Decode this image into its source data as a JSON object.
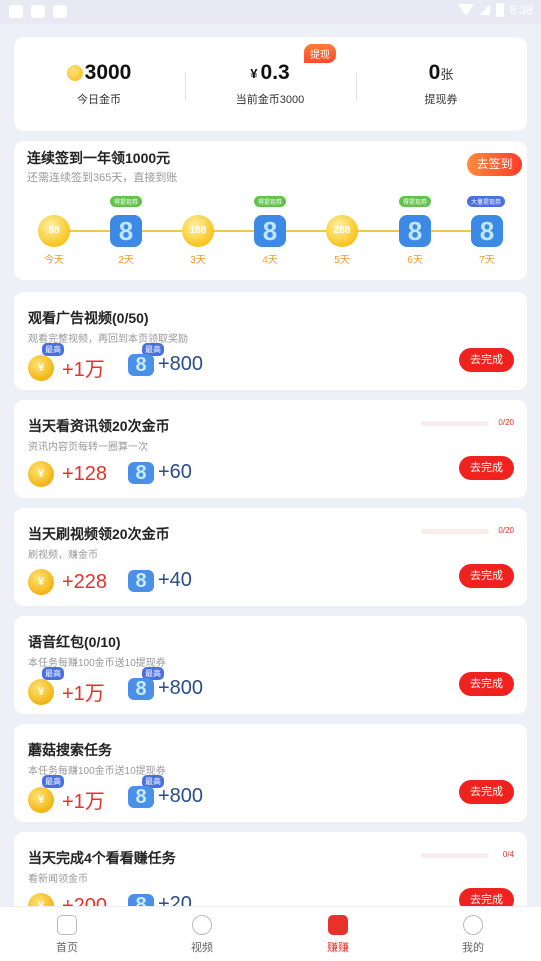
{
  "status_bar": {
    "time": "8:38"
  },
  "stats": {
    "coins_today": {
      "value": "3000",
      "label": "今日金币"
    },
    "current": {
      "yen": "¥",
      "value": "0.3",
      "label": "当前金币3000",
      "tag": "提现"
    },
    "vouchers": {
      "value": "0",
      "unit": "张",
      "label": "提现券"
    }
  },
  "signin": {
    "title": "连续签到一年领1000元",
    "subtitle": "还需连续签到365天，直接到账",
    "button": "去签到",
    "days": [
      {
        "label": "今天",
        "reward": "88",
        "type": "coin"
      },
      {
        "label": "2天",
        "type": "ticket",
        "tag": "得提现券"
      },
      {
        "label": "3天",
        "reward": "188",
        "type": "coin"
      },
      {
        "label": "4天",
        "type": "ticket",
        "tag": "得提现券"
      },
      {
        "label": "5天",
        "reward": "288",
        "type": "coin"
      },
      {
        "label": "6天",
        "type": "ticket",
        "tag": "得提现券"
      },
      {
        "label": "7天",
        "type": "ticket",
        "tag": "大量提现券"
      }
    ]
  },
  "tasks": [
    {
      "title": "观看广告视频(0/50)",
      "desc": "观看完整视频，再回到本页领取奖励",
      "coin": "+1万",
      "ticket": "+800",
      "max_coin": "最高",
      "max_ticket": "最高",
      "button": "去完成"
    },
    {
      "title": "当天看资讯领20次金币",
      "desc": "资讯内容页每转一圈算一次",
      "coin": "+128",
      "ticket": "+60",
      "progress_text": "0/20",
      "progress": 0,
      "button": "去完成"
    },
    {
      "title": "当天刷视频领20次金币",
      "desc": "刷视频，赚金币",
      "coin": "+228",
      "ticket": "+40",
      "progress_text": "0/20",
      "progress": 0,
      "button": "去完成"
    },
    {
      "title": "语音红包(0/10)",
      "desc": "本任务每赚100金币送10提现券",
      "coin": "+1万",
      "ticket": "+800",
      "max_coin": "最高",
      "max_ticket": "最高",
      "button": "去完成"
    },
    {
      "title": "蘑菇搜索任务",
      "desc": "本任务每赚100金币送10提现券",
      "coin": "+1万",
      "ticket": "+800",
      "max_coin": "最高",
      "max_ticket": "最高",
      "button": "去完成"
    },
    {
      "title": "当天完成4个看看赚任务",
      "desc": "看新闻领金币",
      "coin": "+200",
      "ticket": "+20",
      "progress_text": "0/4",
      "progress": 0,
      "button": "去完成"
    }
  ],
  "coin_glyph": "¥",
  "nav": [
    {
      "label": "首页",
      "active": false
    },
    {
      "label": "视频",
      "active": false
    },
    {
      "label": "赚赚",
      "active": true
    },
    {
      "label": "我的",
      "active": false
    }
  ]
}
